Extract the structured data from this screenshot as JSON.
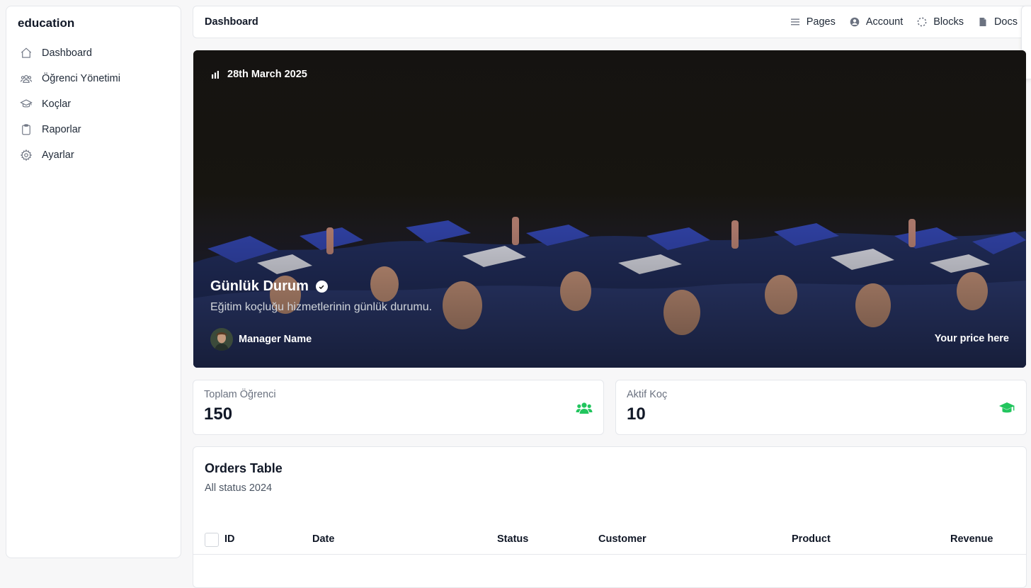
{
  "sidebar": {
    "brand": "education",
    "items": [
      {
        "label": "Dashboard",
        "icon": "home-icon"
      },
      {
        "label": "Öğrenci Yönetimi",
        "icon": "users-icon"
      },
      {
        "label": "Koçlar",
        "icon": "graduation-cap-icon"
      },
      {
        "label": "Raporlar",
        "icon": "clipboard-icon"
      },
      {
        "label": "Ayarlar",
        "icon": "gear-icon"
      }
    ]
  },
  "topbar": {
    "title": "Dashboard",
    "links": [
      {
        "label": "Pages",
        "icon": "menu-lines-icon"
      },
      {
        "label": "Account",
        "icon": "user-circle-icon"
      },
      {
        "label": "Blocks",
        "icon": "dashed-circle-icon"
      },
      {
        "label": "Docs",
        "icon": "document-icon"
      }
    ]
  },
  "hero": {
    "date": "28th March 2025",
    "title": "Günlük Durum",
    "subtitle": "Eğitim koçluğu hizmetlerinin günlük durumu.",
    "manager": "Manager Name",
    "price": "Your price here"
  },
  "stats": [
    {
      "label": "Toplam Öğrenci",
      "value": "150",
      "icon": "users-icon"
    },
    {
      "label": "Aktif Koç",
      "value": "10",
      "icon": "graduation-cap-icon"
    }
  ],
  "orders": {
    "title": "Orders Table",
    "subtitle": "All status 2024",
    "columns": [
      "ID",
      "Date",
      "Status",
      "Customer",
      "Product",
      "Revenue"
    ]
  },
  "colors": {
    "accent_green": "#22c55e"
  }
}
